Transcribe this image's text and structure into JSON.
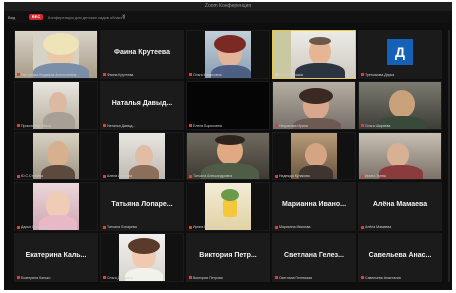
{
  "window": {
    "title": "Zoom Конференция"
  },
  "toolbar": {
    "view_label": "Вид",
    "rec_label": "REC",
    "info_text": "Конференция для детских садов области",
    "close_label": "×"
  },
  "participants": [
    {
      "label": "Пастухова Людмила Анатольевна",
      "display": "",
      "camera": true,
      "active": false
    },
    {
      "label": "Фаина Крутеева",
      "display": "Фаина Крутеева",
      "camera": false,
      "active": false
    },
    {
      "label": "Ольга Марксовна",
      "display": "",
      "camera": true,
      "active": false
    },
    {
      "label": "Андрей Глазов",
      "display": "",
      "camera": true,
      "active": true
    },
    {
      "label": "Третьякова Дарья",
      "display": "",
      "camera": false,
      "avatar_letter": "Д",
      "active": false
    },
    {
      "label": "Прокопенко Ольга",
      "display": "",
      "camera": true,
      "active": false
    },
    {
      "label": "Наталья Давыд...",
      "display": "Наталья Давыд...",
      "camera": false,
      "active": false
    },
    {
      "label": "Елена Борисовна",
      "display": "",
      "camera": true,
      "active": false
    },
    {
      "label": "Некрасова Ирина",
      "display": "",
      "camera": true,
      "active": false
    },
    {
      "label": "Ольга Ширяева",
      "display": "",
      "camera": true,
      "active": false
    },
    {
      "label": "Ю.С.Степина",
      "display": "",
      "camera": true,
      "active": false
    },
    {
      "label": "Алена Иванова",
      "display": "",
      "camera": true,
      "active": false
    },
    {
      "label": "Татьяна Александровна",
      "display": "",
      "camera": true,
      "active": false
    },
    {
      "label": "Надежда Кулакова",
      "display": "",
      "camera": true,
      "active": false
    },
    {
      "label": "Ирина Зуева",
      "display": "",
      "camera": true,
      "active": false
    },
    {
      "label": "Дарья Лукьянова",
      "display": "",
      "camera": true,
      "active": false
    },
    {
      "label": "Татьяна Лопарева",
      "display": "Татьяна Лопаре...",
      "camera": false,
      "active": false
    },
    {
      "label": "Ирина Николаева",
      "display": "",
      "camera": true,
      "active": false
    },
    {
      "label": "Марианна Иванова",
      "display": "Марианна Ивано...",
      "camera": false,
      "active": false
    },
    {
      "label": "Алёна Мамаева",
      "display": "Алёна Мамаева",
      "camera": false,
      "active": false
    },
    {
      "label": "Екатерина Калько",
      "display": "Екатерина Каль...",
      "camera": false,
      "active": false
    },
    {
      "label": "Ольга Дорогина",
      "display": "",
      "camera": true,
      "active": false
    },
    {
      "label": "Виктория Петрова",
      "display": "Виктория Петр...",
      "camera": false,
      "active": false
    },
    {
      "label": "Светлана Гелевская",
      "display": "Светлана Гелез...",
      "camera": false,
      "active": false
    },
    {
      "label": "Савельева Анастасия",
      "display": "Савельева Анас...",
      "camera": false,
      "active": false
    }
  ],
  "colors": {
    "tile_bg": "#1b1b1b",
    "active_border": "#e6c84a",
    "rec_red": "#d8282f",
    "avatar_blue": "#1561b8",
    "muted_mic": "#e23b3b"
  }
}
